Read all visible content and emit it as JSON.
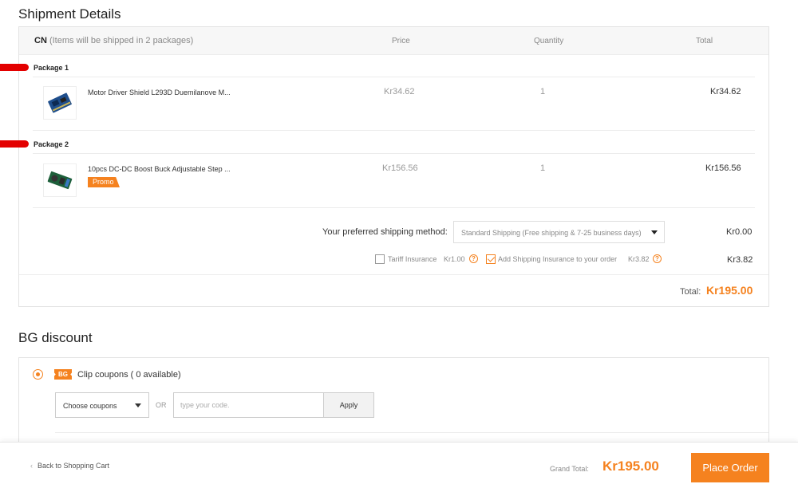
{
  "shipment": {
    "title": "Shipment Details",
    "header": {
      "country": "CN",
      "note": "(Items will be shipped in 2 packages)",
      "col_price": "Price",
      "col_quantity": "Quantity",
      "col_total": "Total"
    },
    "packages": [
      {
        "label": "Package 1",
        "item": {
          "name": "Motor Driver Shield L293D Duemilanove M...",
          "price": "Kr34.62",
          "quantity": "1",
          "total": "Kr34.62"
        }
      },
      {
        "label": "Package 2",
        "item": {
          "name": "10pcs DC-DC Boost Buck Adjustable Step ...",
          "price": "Kr156.56",
          "quantity": "1",
          "total": "Kr156.56",
          "badge": "Promo"
        }
      }
    ],
    "shipping_method": {
      "label": "Your preferred shipping method:",
      "selected": "Standard Shipping (Free shipping & 7-25 business days)",
      "cost": "Kr0.00"
    },
    "options": {
      "tariff": {
        "label": "Tariff Insurance",
        "price": "Kr1.00",
        "checked": false
      },
      "shipping_insurance": {
        "label": "Add Shipping Insurance to your order",
        "price": "Kr3.82",
        "checked": true
      },
      "cost": "Kr3.82"
    },
    "total_label": "Total:",
    "total_value": "Kr195.00"
  },
  "discount": {
    "title": "BG discount",
    "coupon_icon_text": "BG",
    "coupon_label": "Clip coupons ( 0 available)",
    "coupon_select": "Choose coupons",
    "or": "OR",
    "code_placeholder": "type your code.",
    "apply": "Apply"
  },
  "footer": {
    "back": "Back to Shopping Cart",
    "grand_total_label": "Grand Total:",
    "grand_total_value": "Kr195.00",
    "place_order": "Place Order"
  },
  "colors": {
    "accent": "#f5821f",
    "redaction": "#e30000"
  }
}
